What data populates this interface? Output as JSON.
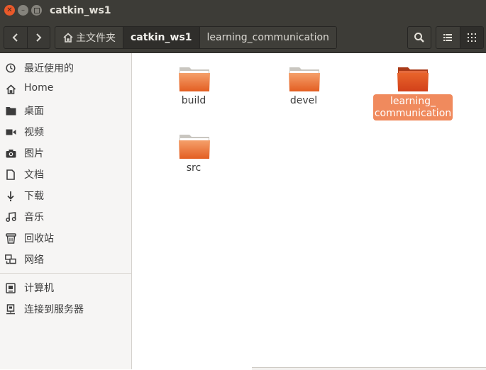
{
  "window": {
    "title": "catkin_ws1"
  },
  "toolbar": {
    "breadcrumbs": [
      {
        "label": "主文件夹"
      },
      {
        "label": "catkin_ws1"
      },
      {
        "label": "learning_communication"
      }
    ]
  },
  "sidebar": {
    "items": [
      {
        "label": "最近使用的",
        "icon": "clock-icon"
      },
      {
        "label": "Home",
        "icon": "home-icon"
      },
      {
        "label": "桌面",
        "icon": "folder-icon"
      },
      {
        "label": "视频",
        "icon": "video-icon"
      },
      {
        "label": "图片",
        "icon": "camera-icon"
      },
      {
        "label": "文档",
        "icon": "document-icon"
      },
      {
        "label": "下载",
        "icon": "download-icon"
      },
      {
        "label": "音乐",
        "icon": "music-icon"
      },
      {
        "label": "回收站",
        "icon": "trash-icon"
      },
      {
        "label": "网络",
        "icon": "network-icon"
      },
      {
        "label": "计算机",
        "icon": "computer-icon"
      },
      {
        "label": "连接到服务器",
        "icon": "server-icon"
      }
    ]
  },
  "files": [
    {
      "label": "build"
    },
    {
      "label": "devel"
    },
    {
      "label": "learning_communication",
      "label_lines": [
        "learning_",
        "communication"
      ],
      "selected": true
    },
    {
      "label": "src"
    }
  ],
  "colors": {
    "accent": "#f08a5d",
    "folder": "#e8642a",
    "close": "#e9592a"
  }
}
